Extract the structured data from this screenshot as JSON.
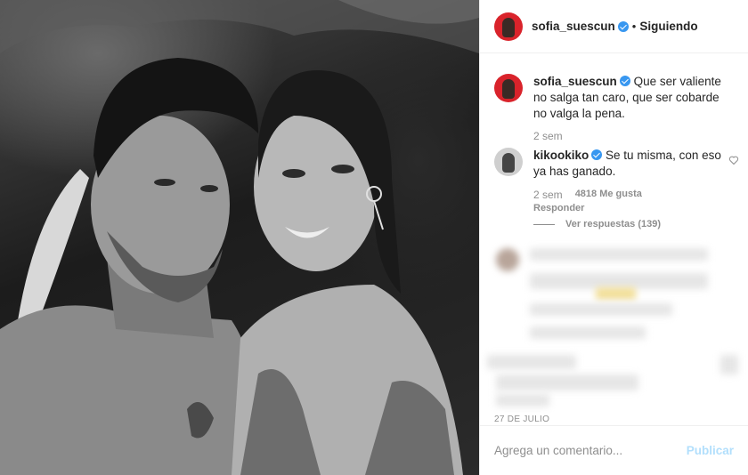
{
  "post": {
    "image_alt_icon": "photo-black-and-white-couple"
  },
  "header": {
    "username": "sofia_suescun",
    "separator": "•",
    "follow_state": "Siguiendo"
  },
  "caption": {
    "username": "sofia_suescun",
    "text": "Que ser valiente no salga tan caro, que ser cobarde no valga la pena.",
    "time": "2 sem"
  },
  "comment": {
    "username": "kikookiko",
    "text": "Se tu misma, con eso ya has ganado.",
    "time": "2 sem",
    "likes": "4818 Me gusta",
    "reply_label": "Responder",
    "view_replies": "Ver respuestas (139)"
  },
  "post_date": "27 DE JULIO",
  "add_comment": {
    "placeholder": "Agrega un comentario...",
    "publish_label": "Publicar"
  },
  "colors": {
    "verified": "#3897f0",
    "publish_disabled": "#b2dffc",
    "avatar_ring": "#d9232b"
  }
}
